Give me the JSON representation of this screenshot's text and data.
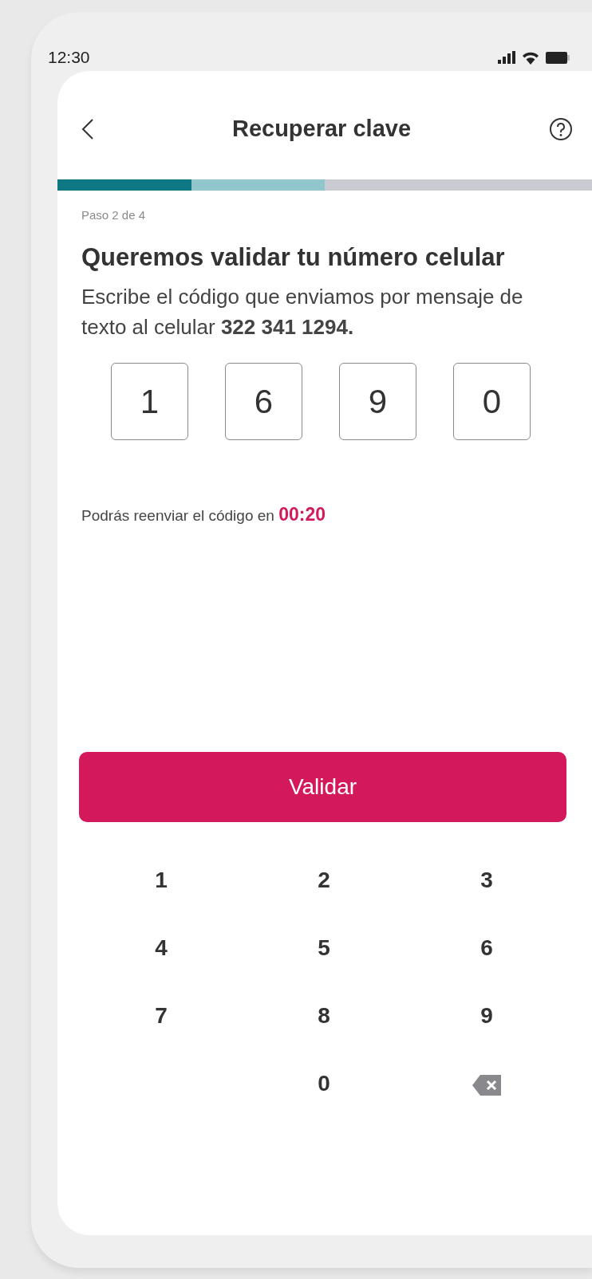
{
  "status_bar": {
    "time": "12:30"
  },
  "header": {
    "title": "Recuperar clave"
  },
  "progress": {
    "segments": [
      {
        "complete": true,
        "current": false
      },
      {
        "complete": false,
        "current": true
      },
      {
        "complete": false,
        "current": false
      },
      {
        "complete": false,
        "current": false
      }
    ]
  },
  "step_label": "Paso 2 de 4",
  "heading": "Queremos validar tu número celular",
  "description": "Escribe el código que enviamos por mensaje de texto al celular **322 341 1294.**",
  "code_digits": [
    "1",
    "6",
    "9",
    "0"
  ],
  "resend": {
    "text": "Podrás reenviar el código en",
    "countdown": "00:20"
  },
  "primary_button": "Validar",
  "keypad": {
    "rows": [
      {
        "keys": [
          {
            "kind": "digit",
            "label": "1"
          },
          {
            "kind": "digit",
            "label": "2"
          },
          {
            "kind": "digit",
            "label": "3"
          }
        ]
      },
      {
        "keys": [
          {
            "kind": "digit",
            "label": "4"
          },
          {
            "kind": "digit",
            "label": "5"
          },
          {
            "kind": "digit",
            "label": "6"
          }
        ]
      },
      {
        "keys": [
          {
            "kind": "digit",
            "label": "7"
          },
          {
            "kind": "digit",
            "label": "8"
          },
          {
            "kind": "digit",
            "label": "9"
          }
        ]
      },
      {
        "keys": [
          {
            "kind": "digit",
            "label": "0"
          },
          {
            "kind": "backspace"
          }
        ]
      }
    ]
  }
}
